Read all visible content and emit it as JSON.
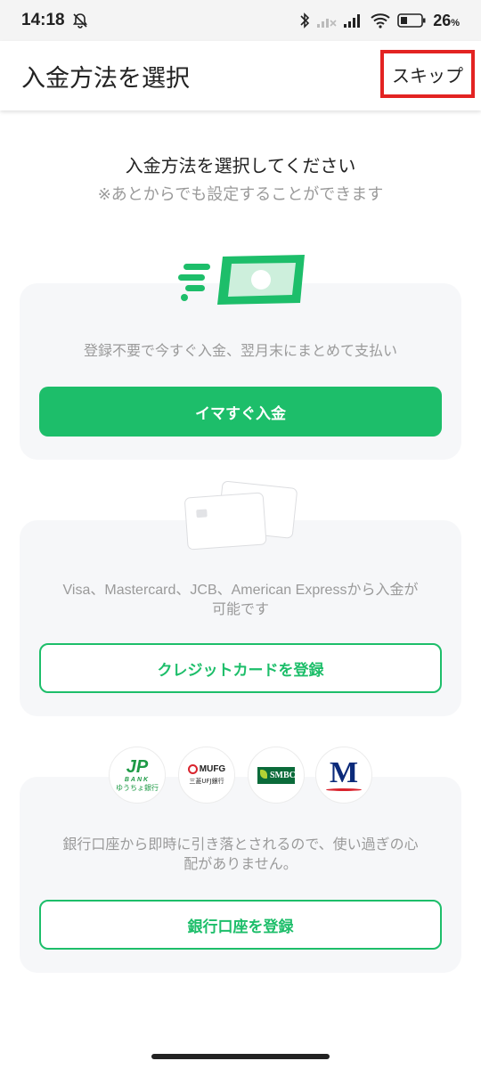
{
  "status_bar": {
    "time": "14:18",
    "battery_percent": "26",
    "battery_percent_suffix": "%",
    "icons": [
      "muted-bell-icon",
      "bluetooth-icon",
      "signal-icon",
      "signal-icon",
      "wifi-icon",
      "battery-icon"
    ]
  },
  "header": {
    "title": "入金方法を選択",
    "skip_label": "スキップ"
  },
  "intro": {
    "title": "入金方法を選択してください",
    "subtitle": "※あとからでも設定することができます"
  },
  "options": [
    {
      "description": "登録不要で今すぐ入金、翌月末にまとめて支払い",
      "button_label": "イマすぐ入金",
      "icon": "cash-icon"
    },
    {
      "description_line1": "Visa、Mastercard、JCB、American Expressから入金が",
      "description_line2": "可能です",
      "button_label": "クレジットカードを登録",
      "icon": "credit-card-icon"
    },
    {
      "description_line1": "銀行口座から即時に引き落とされるので、使い過ぎの心",
      "description_line2": "配がありません。",
      "button_label": "銀行口座を登録",
      "banks": [
        {
          "logo_text": "JP",
          "logo_sub": "BANK",
          "caption": "ゆうちょ銀行"
        },
        {
          "logo_text": "MUFG",
          "caption": "三菱UFJ銀行"
        },
        {
          "logo_text": "SMBC"
        },
        {
          "logo_text": "M"
        }
      ]
    }
  ],
  "colors": {
    "accent": "#1dbe6a",
    "highlight_border": "#e32322",
    "card_bg": "#f6f7f9"
  }
}
